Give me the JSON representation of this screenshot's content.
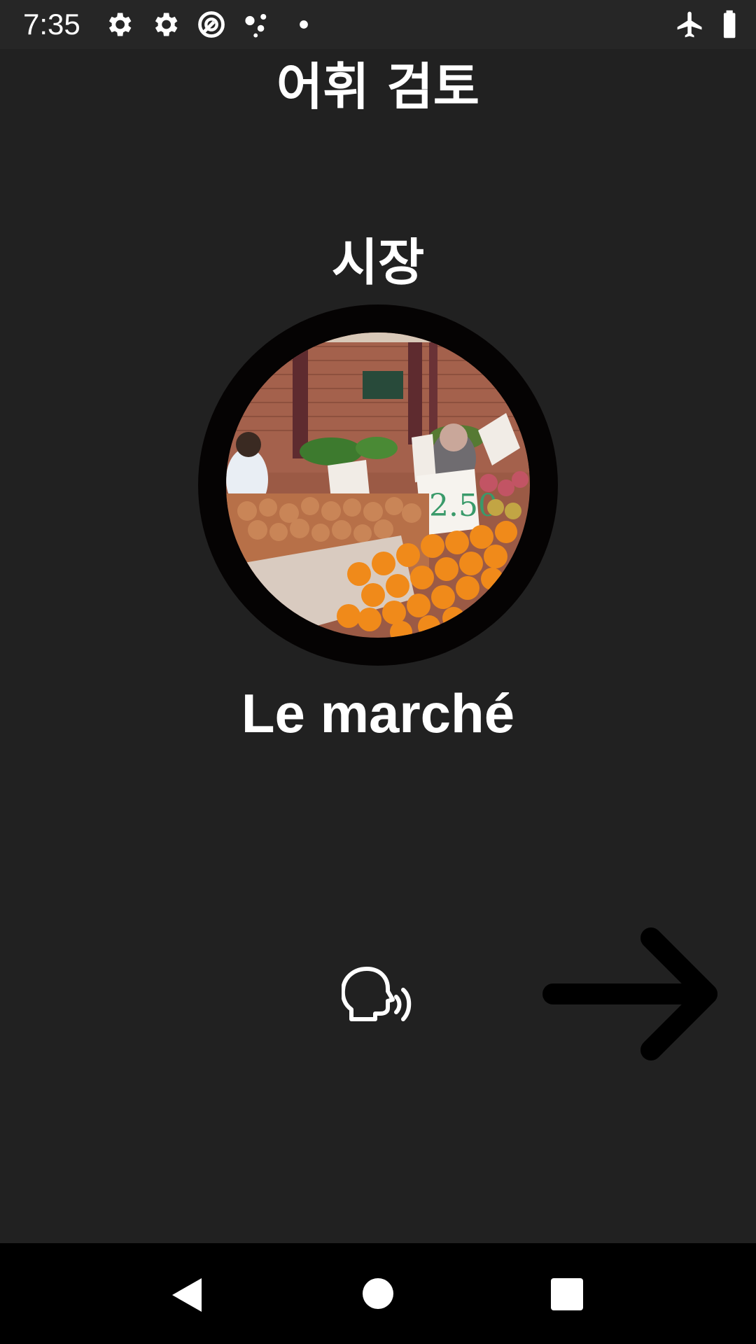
{
  "status_bar": {
    "time": "7:35",
    "icons": [
      "gear-icon",
      "gear-icon",
      "data-saver-icon",
      "assistant-dots-icon",
      "notification-dot-icon",
      "airplane-icon",
      "battery-icon"
    ]
  },
  "header": {
    "title": "어휘 검토"
  },
  "flashcard": {
    "native_word": "시장",
    "foreign_word": "Le marché",
    "image_subject": "market produce stall",
    "price_sign": "2.50"
  },
  "controls": {
    "speak_icon": "speaking-head-icon",
    "next_icon": "arrow-right-icon"
  },
  "nav_bar": {
    "back_icon": "back-triangle-icon",
    "home_icon": "home-circle-icon",
    "recents_icon": "recents-square-icon"
  },
  "colors": {
    "background": "#212121",
    "status_bar": "#262626",
    "nav_bar": "#000000",
    "text": "#ffffff",
    "ring": "#050303",
    "orange": "#f08a1a"
  }
}
